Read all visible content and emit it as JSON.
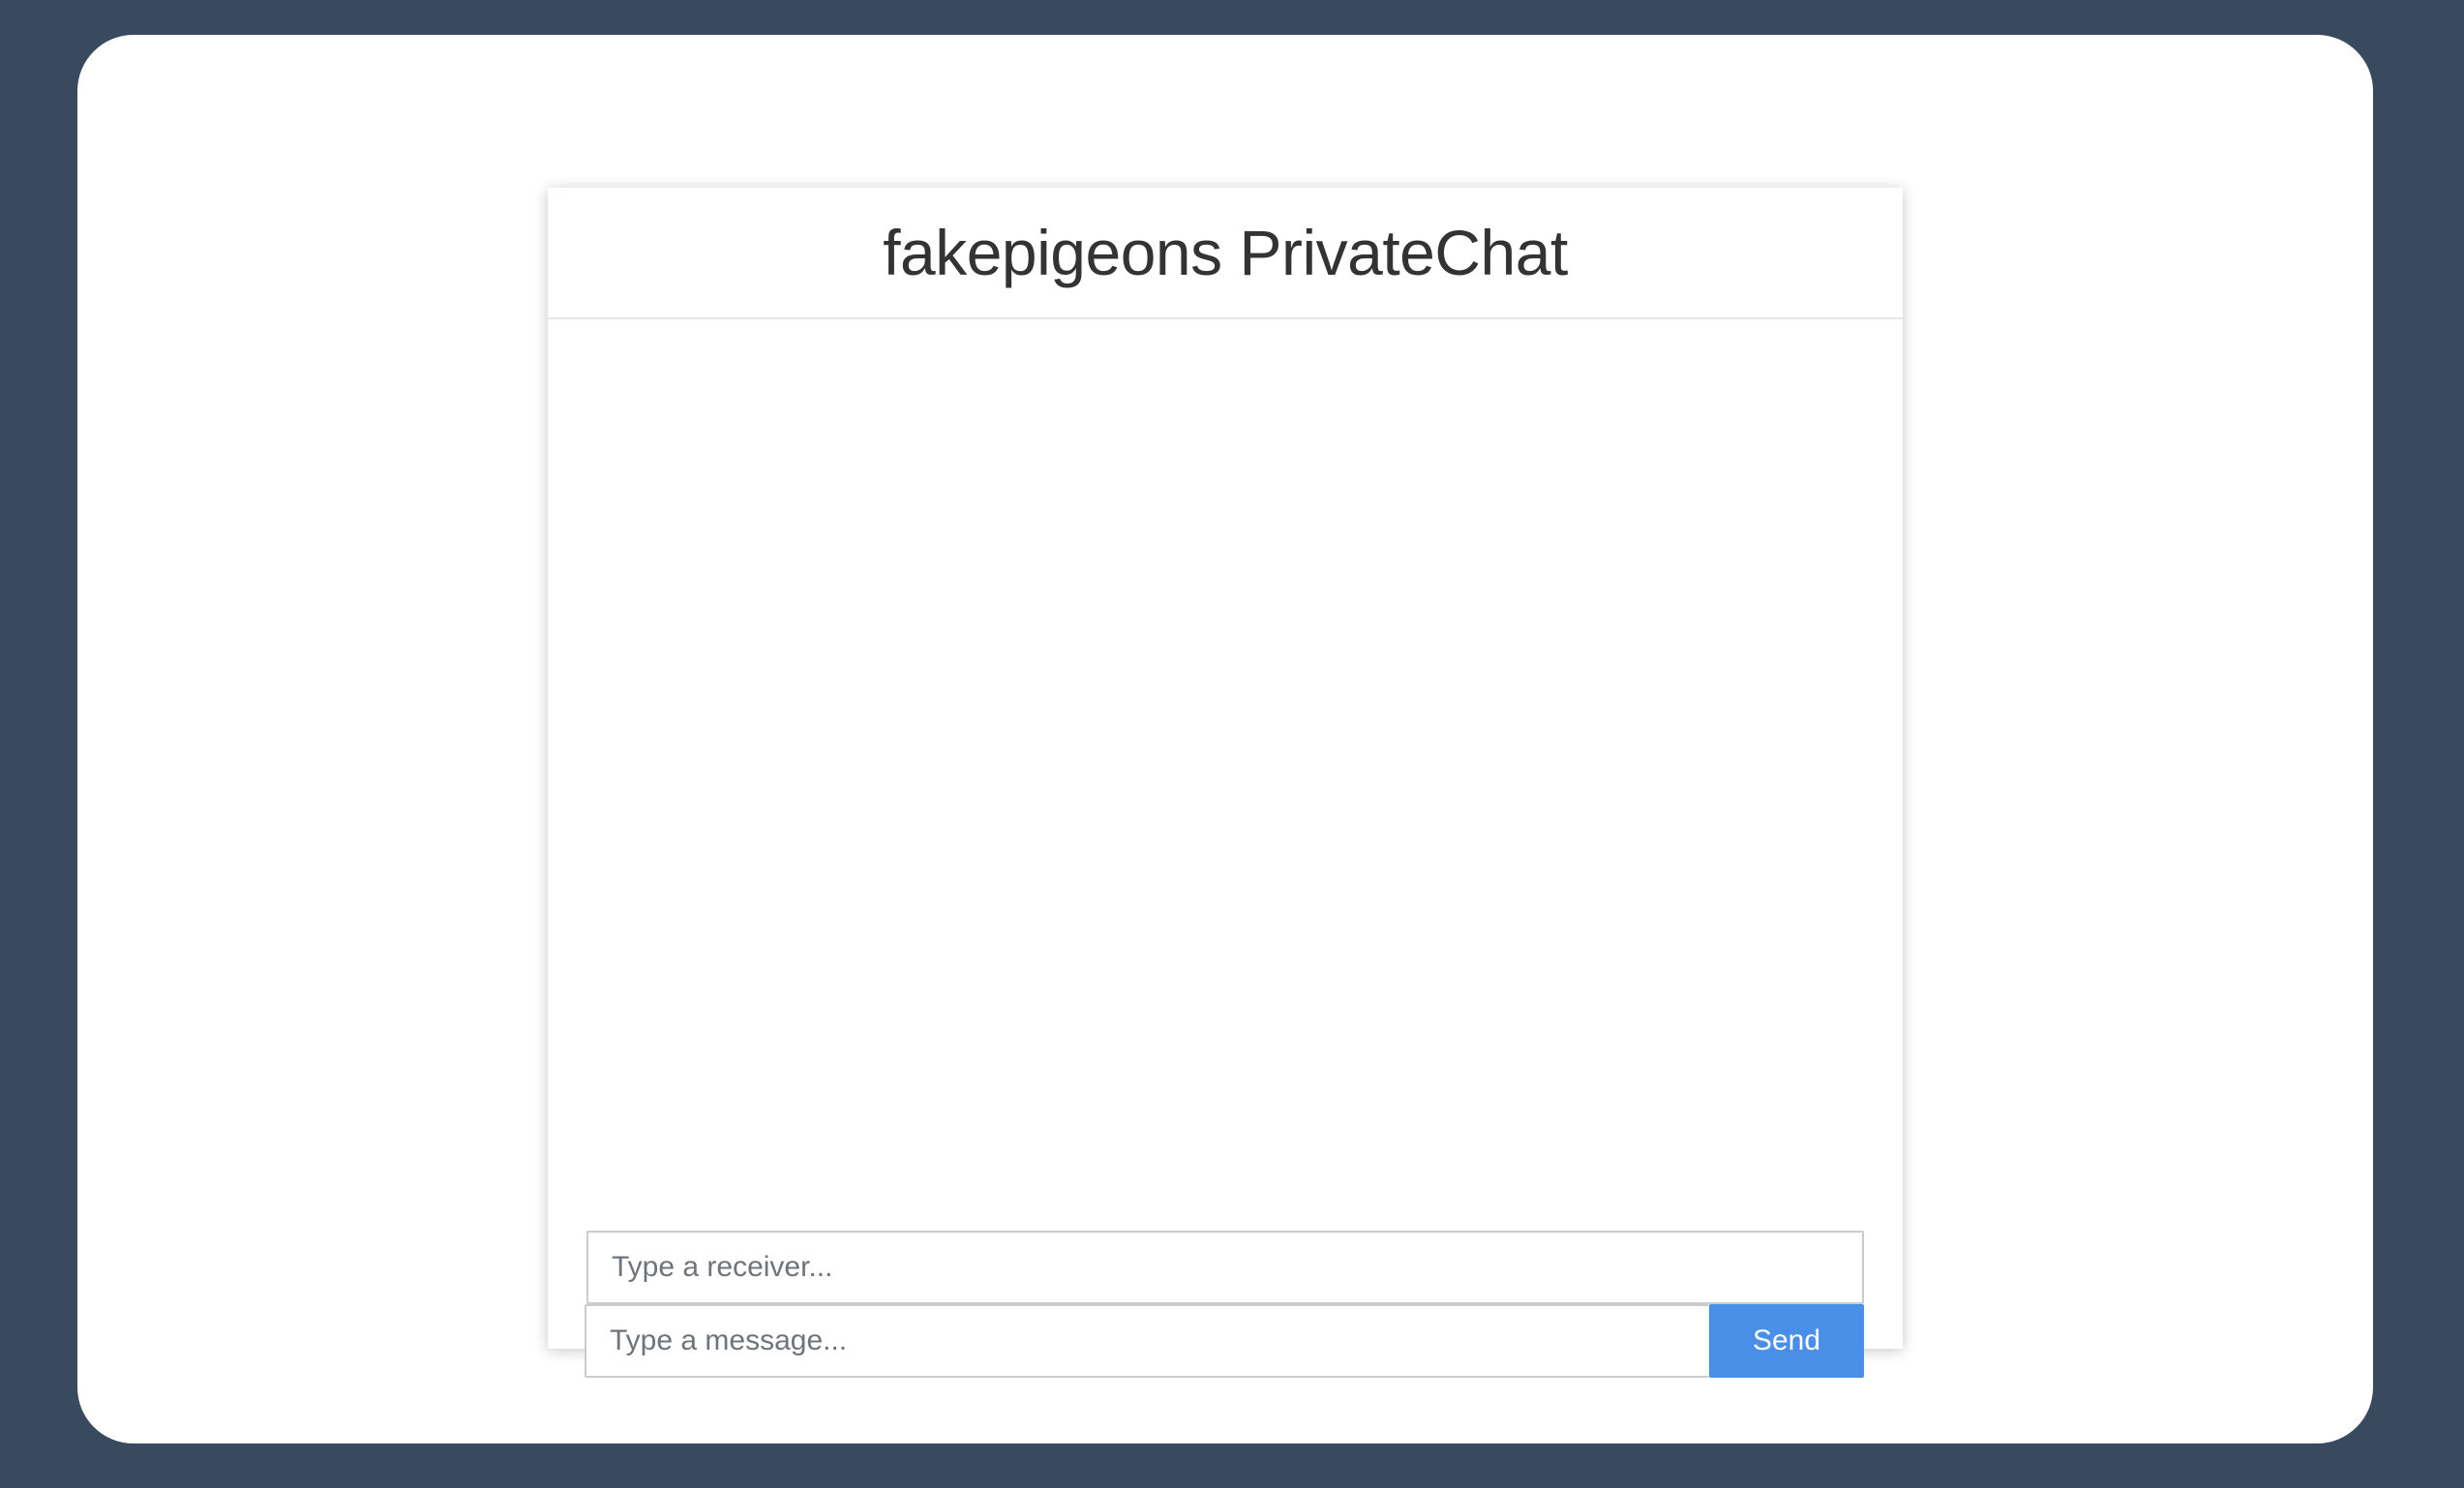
{
  "app": {
    "title": "fakepigeons PrivateChat"
  },
  "chat": {
    "messages": []
  },
  "composer": {
    "receiver_placeholder": "Type a receiver...",
    "receiver_value": "",
    "message_placeholder": "Type a message...",
    "message_value": "",
    "send_label": "Send"
  },
  "colors": {
    "background": "#3a4a5e",
    "card": "#ffffff",
    "send_button": "#4a8fe7",
    "title_text": "#333333"
  }
}
